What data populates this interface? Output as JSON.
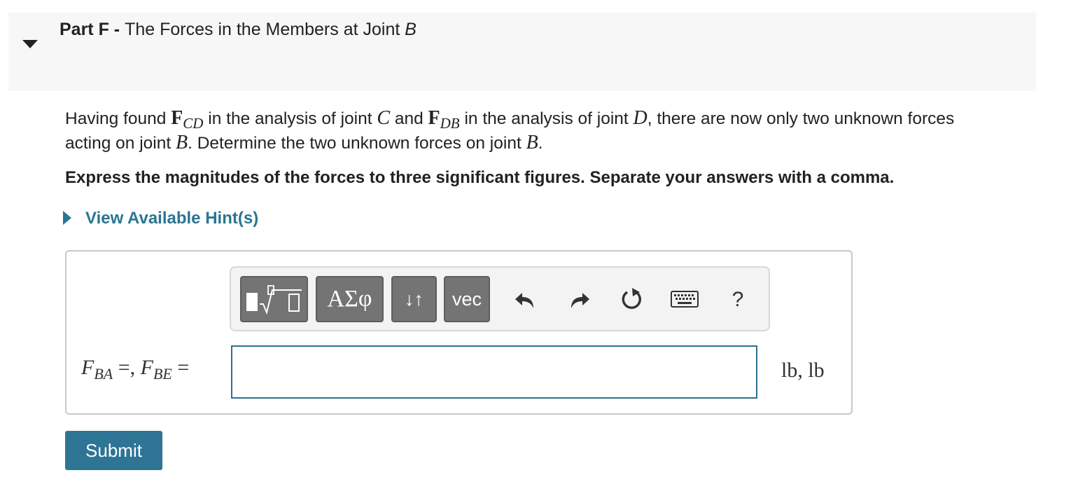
{
  "part": {
    "label": "Part F",
    "separator": " - ",
    "title_text": "The Forces in the Members at Joint ",
    "title_joint": "B"
  },
  "question": {
    "t1": "Having found ",
    "f1_bold": "F",
    "f1_sub": "CD",
    "t2": " in the analysis of joint ",
    "j1": "C",
    "t3": " and ",
    "f2_bold": "F",
    "f2_sub": "DB",
    "t4": " in the analysis of joint ",
    "j2": "D",
    "t5": ", there are now only two unknown forces acting on joint ",
    "j3": "B",
    "t6": ". Determine the two unknown forces on joint ",
    "j4": "B",
    "t7": "."
  },
  "instruction": "Express the magnitudes of the forces to three significant figures. Separate your answers with a comma.",
  "hint_link": "View Available Hint(s)",
  "toolbar": {
    "symbols_label": "ΑΣφ",
    "arrows_label": "↓↑",
    "vec_label": "vec",
    "help_label": "?"
  },
  "equation": {
    "var1": "F",
    "sub1": "BA",
    "mid": " =, ",
    "var2": "F",
    "sub2": "BE",
    "end": " ="
  },
  "answer": {
    "value": "",
    "placeholder": ""
  },
  "units": "lb, lb",
  "submit_label": "Submit"
}
